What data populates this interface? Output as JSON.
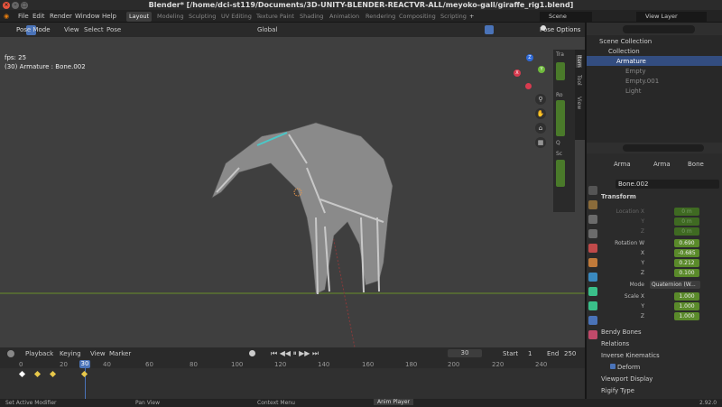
{
  "title": "Blender* [/home/dci-st119/Documents/3D-UNITY-BLENDER-REACTVR-ALL/meyoko-gall/giraffe_rig1.blend]",
  "menu": [
    "File",
    "Edit",
    "Render",
    "Window",
    "Help"
  ],
  "workspaces": [
    "Layout",
    "Modeling",
    "Sculpting",
    "UV Editing",
    "Texture Paint",
    "Shading",
    "Animation",
    "Rendering",
    "Compositing",
    "Scripting"
  ],
  "add_ws": "+",
  "scene": "Scene",
  "view_layer": "View Layer",
  "viewport_header": {
    "mode": "Pose Mode",
    "view": "View",
    "select": "Select",
    "pose": "Pose",
    "orientation": "Global",
    "pose_options": "Pose Options"
  },
  "overlay": {
    "fps": "fps: 25",
    "object": "(30) Armature : Bone.002"
  },
  "gizmo": {
    "z": "Z",
    "y": "Y",
    "x": "X"
  },
  "sidebar_tabs": [
    "Item",
    "Tool",
    "View"
  ],
  "sidebar_snips": {
    "trans": "Tra",
    "ro": "Ro",
    "sc": "Sc",
    "q": "Q"
  },
  "outliner": {
    "search_icon": "search",
    "items": [
      {
        "label": "Scene Collection"
      },
      {
        "label": "Collection"
      },
      {
        "label": "Armature"
      },
      {
        "label": "Empty"
      },
      {
        "label": "Empty.001"
      },
      {
        "label": "Light"
      }
    ]
  },
  "properties": {
    "tabs_top": [
      "Arma",
      "Arma",
      "Bone"
    ],
    "bone_name": "Bone.002",
    "transform_header": "Transform",
    "location_label": "Location X",
    "loc_y_label": "Y",
    "loc_z_label": "Z",
    "loc_vals": [
      "0 m",
      "0 m",
      "0 m"
    ],
    "rotation_label": "Rotation W",
    "rot_x_label": "X",
    "rot_y_label": "Y",
    "rot_z_label": "Z",
    "rot_vals": [
      "0.690",
      "-0.685",
      "0.212",
      "0.100"
    ],
    "mode_label": "Mode",
    "mode_value": "Quaternion (W...",
    "scale_label": "Scale X",
    "scale_y_label": "Y",
    "scale_z_label": "Z",
    "scale_vals": [
      "1.000",
      "1.000",
      "1.000"
    ],
    "sections": [
      "Bendy Bones",
      "Relations",
      "Inverse Kinematics",
      "Deform",
      "Viewport Display",
      "Rigify Type"
    ]
  },
  "timeline": {
    "playback": "Playback",
    "keying": "Keying",
    "view": "View",
    "marker": "Marker",
    "current_frame": "30",
    "start_label": "Start",
    "start": "1",
    "end_label": "End",
    "end": "250",
    "ticks": [
      "0",
      "20",
      "30",
      "40",
      "60",
      "80",
      "100",
      "120",
      "140",
      "160",
      "180",
      "200",
      "220",
      "240"
    ]
  },
  "status": {
    "set_active": "Set Active Modifier",
    "pan": "Pan View",
    "context": "Context Menu",
    "anim": "Anim Player",
    "version": "2.92.0"
  },
  "colors": {
    "accent": "#4a73b8",
    "green": "#5a8a2a",
    "keyframe": "#e8c84a"
  }
}
